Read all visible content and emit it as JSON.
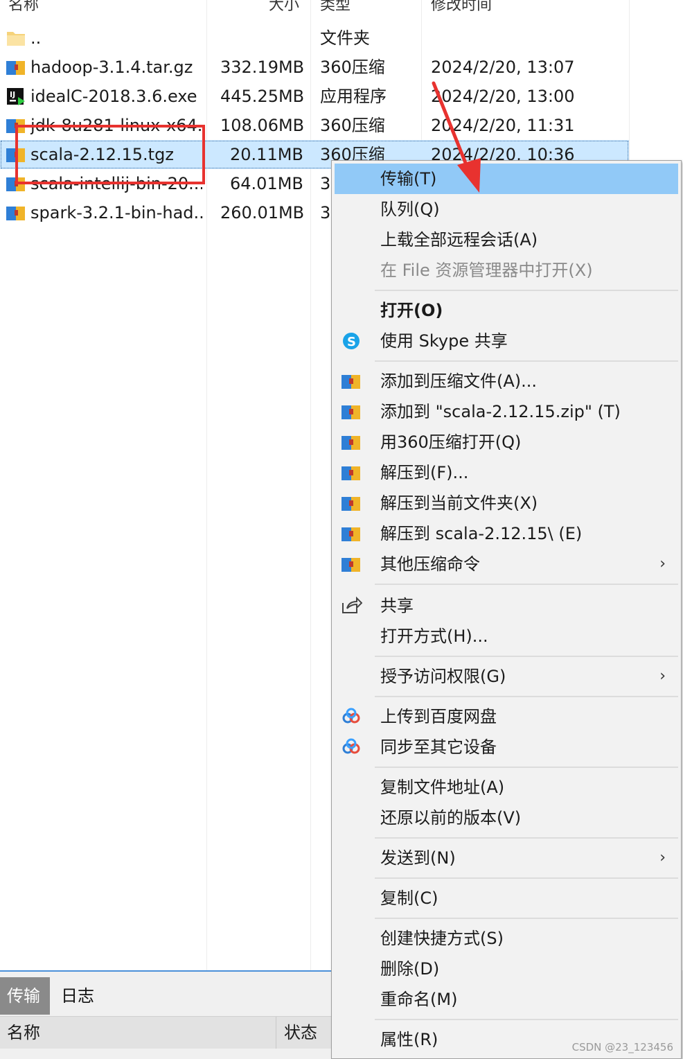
{
  "columns": {
    "name": "名称",
    "size": "大小",
    "type": "类型",
    "modified": "修改时间"
  },
  "files": [
    {
      "name": "..",
      "size": "",
      "type": "文件夹",
      "modified": "",
      "icon": "folder-icon"
    },
    {
      "name": "hadoop-3.1.4.tar.gz",
      "size": "332.19MB",
      "type": "360压缩",
      "modified": "2024/2/20, 13:07",
      "icon": "archive-icon"
    },
    {
      "name": "idealC-2018.3.6.exe",
      "size": "445.25MB",
      "type": "应用程序",
      "modified": "2024/2/20, 13:00",
      "icon": "intellij-icon"
    },
    {
      "name": "jdk-8u281-linux-x64...",
      "size": "108.06MB",
      "type": "360压缩",
      "modified": "2024/2/20, 11:31",
      "icon": "archive-icon"
    },
    {
      "name": "scala-2.12.15.tgz",
      "size": "20.11MB",
      "type": "360压缩",
      "modified": "2024/2/20, 10:36",
      "icon": "archive-icon",
      "selected": true
    },
    {
      "name": "scala-intellij-bin-20...",
      "size": "64.01MB",
      "type": "3",
      "modified": "",
      "icon": "archive-icon"
    },
    {
      "name": "spark-3.2.1-bin-had...",
      "size": "260.01MB",
      "type": "3",
      "modified": "",
      "icon": "archive-icon"
    }
  ],
  "bottom_panel": {
    "tabs": [
      "传输",
      "日志"
    ],
    "headers": {
      "name": "名称",
      "status": "状态"
    }
  },
  "context_menu": {
    "transfer": "传输(T)",
    "queue": "队列(Q)",
    "upload_all": "上载全部远程会话(A)",
    "open_explorer": "在 File 资源管理器中打开(X)",
    "open": "打开(O)",
    "skype_share": "使用 Skype 共享",
    "add_archive": "添加到压缩文件(A)...",
    "add_zip": "添加到 \"scala-2.12.15.zip\" (T)",
    "open_360": "用360压缩打开(Q)",
    "extract_to": "解压到(F)...",
    "extract_here": "解压到当前文件夹(X)",
    "extract_folder": "解压到 scala-2.12.15\\ (E)",
    "other_compress": "其他压缩命令",
    "share": "共享",
    "open_with": "打开方式(H)...",
    "grant_access": "授予访问权限(G)",
    "upload_baidu": "上传到百度网盘",
    "sync_devices": "同步至其它设备",
    "copy_path": "复制文件地址(A)",
    "restore_versions": "还原以前的版本(V)",
    "send_to": "发送到(N)",
    "copy": "复制(C)",
    "create_shortcut": "创建快捷方式(S)",
    "delete": "删除(D)",
    "rename": "重命名(M)",
    "properties": "属性(R)",
    "submenu_arrow": "›"
  },
  "watermark": "CSDN @23_123456",
  "colors": {
    "selection": "#cce8ff",
    "menu_highlight": "#91c9f7",
    "annotation": "#e8322f"
  }
}
